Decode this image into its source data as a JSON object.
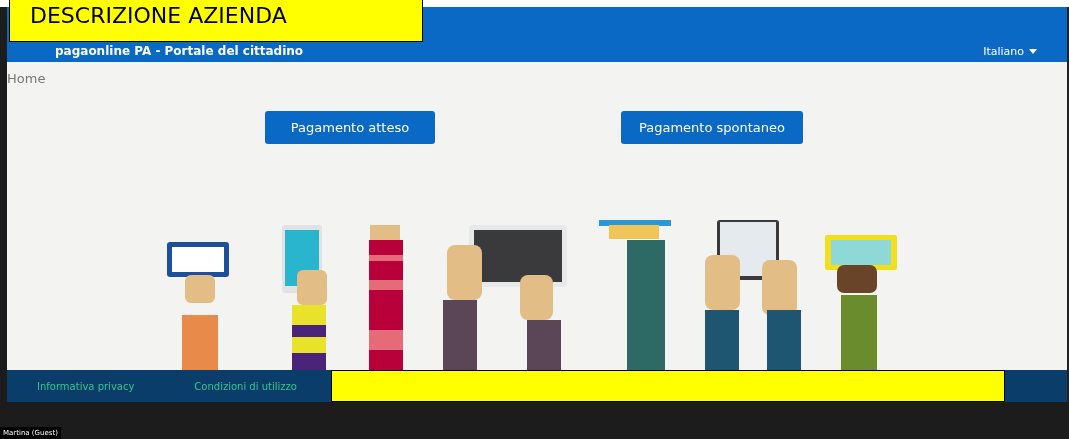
{
  "overlay_label": "DESCRIZIONE AZIENDA",
  "header": {
    "title": "pagaonline PA - Portale del cittadino",
    "language": "Italiano"
  },
  "breadcrumb": "Home",
  "actions": [
    "Pagamento atteso",
    "Pagamento spontaneo"
  ],
  "footer_links": [
    "Informativa privacy",
    "Condizioni di utilizzo"
  ],
  "participant": "Martina (Guest)"
}
